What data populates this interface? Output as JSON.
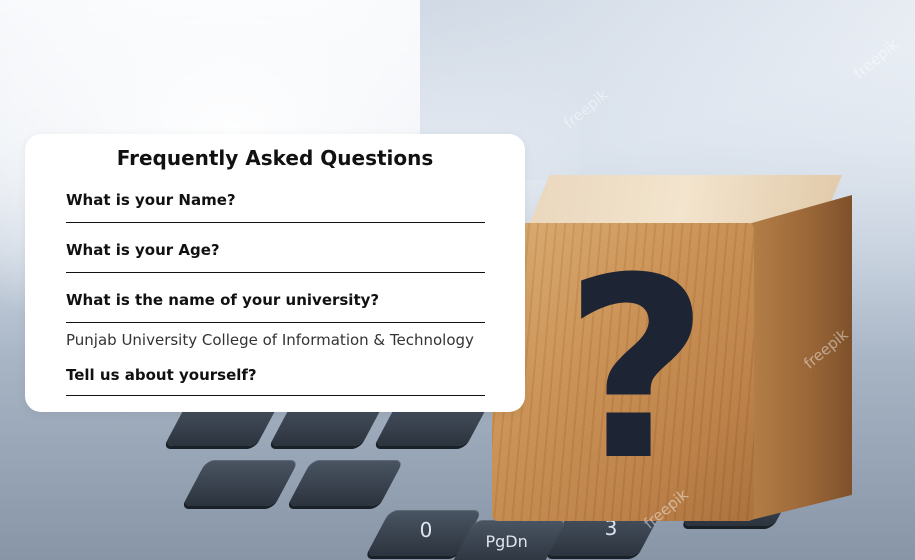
{
  "faq": {
    "title": "Frequently Asked Questions",
    "items": [
      {
        "question": "What is your Name?",
        "answer": "",
        "expanded": false
      },
      {
        "question": "What is your Age?",
        "answer": "",
        "expanded": false
      },
      {
        "question": "What is the name of your university?",
        "answer": "Punjab University College of Information & Technology",
        "expanded": true
      },
      {
        "question": "Tell us about yourself?",
        "answer": "",
        "expanded": false
      }
    ]
  },
  "background": {
    "watermark": "freepik",
    "cube_symbol": "?",
    "key_labels": [
      "0",
      "3",
      "PgDn"
    ]
  },
  "colors": {
    "card": "#ffffff",
    "text": "#111111",
    "rule": "#111111",
    "question_mark": "#1d2434"
  }
}
